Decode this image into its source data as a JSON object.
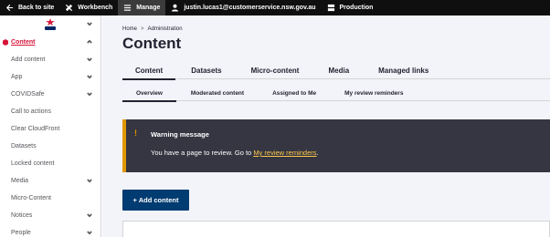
{
  "toolbar": {
    "back_label": "Back to site",
    "workbench_label": "Workbench",
    "manage_label": "Manage",
    "user_label": "justin.lucas1@customerservice.nsw.gov.au",
    "env_label": "Production"
  },
  "sidebar": {
    "items": [
      {
        "label": "Content",
        "chevron": "chevron-up-icon"
      },
      {
        "label": "Add content",
        "chevron": "chevron-down-icon"
      },
      {
        "label": "App",
        "chevron": "chevron-down-icon"
      },
      {
        "label": "COVIDSafe",
        "chevron": "chevron-down-icon"
      },
      {
        "label": "Call to actions"
      },
      {
        "label": "Clear CloudFront"
      },
      {
        "label": "Datasets"
      },
      {
        "label": "Locked content"
      },
      {
        "label": "Media",
        "chevron": "chevron-down-icon"
      },
      {
        "label": "Micro-Content"
      },
      {
        "label": "Notices",
        "chevron": "chevron-down-icon"
      },
      {
        "label": "People",
        "chevron": "chevron-down-icon"
      }
    ]
  },
  "breadcrumb": {
    "home": "Home",
    "separator": ">",
    "current": "Administration"
  },
  "page": {
    "title": "Content"
  },
  "tabs": [
    "Content",
    "Datasets",
    "Micro-content",
    "Media",
    "Managed links"
  ],
  "subtabs": [
    "Overview",
    "Moderated content",
    "Assigned to Me",
    "My review reminders"
  ],
  "warning": {
    "icon": "!",
    "title": "Warning message",
    "text_before": "You have a page to review. Go to ",
    "link": "My review reminders",
    "text_after": "."
  },
  "actions": {
    "add_content": "+ Add content"
  },
  "colors": {
    "accent": "#d7153a",
    "navy": "#003b71",
    "warning": "#e29700",
    "toolbar": "#0f0f0f"
  }
}
